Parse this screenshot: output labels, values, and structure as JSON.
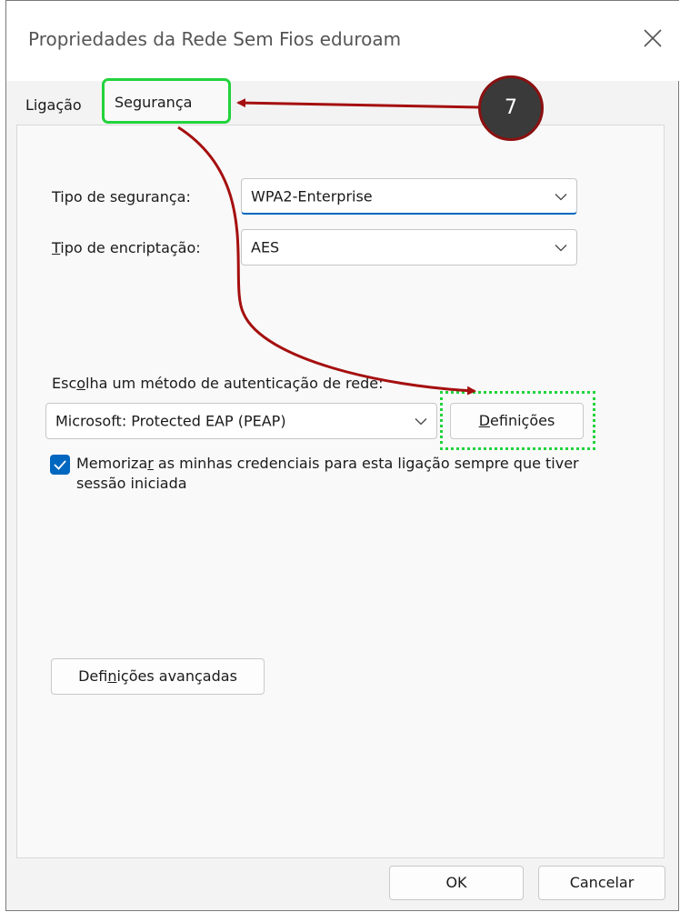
{
  "window": {
    "title": "Propriedades da Rede Sem Fios eduroam",
    "close_icon": "close-icon"
  },
  "tabs": [
    {
      "label": "Ligação"
    },
    {
      "label": "Segurança",
      "selected": true
    }
  ],
  "security": {
    "type_label": {
      "pre": "Tipo de se",
      "u": "g",
      "post": "urança:"
    },
    "type_value": "WPA2-Enterprise",
    "encryption_label": {
      "pre": "",
      "u": "T",
      "post": "ipo de encriptação:"
    },
    "encryption_value": "AES"
  },
  "auth": {
    "label": {
      "pre": "Esc",
      "u": "o",
      "post": "lha um método de autenticação de rede:"
    },
    "method_value": "Microsoft: Protected EAP (PEAP)",
    "settings_button": {
      "pre": "",
      "u": "D",
      "post": "efinições"
    }
  },
  "remember": {
    "checked": true,
    "label": {
      "pre": "Memoriza",
      "u": "r",
      "post": " as minhas credenciais para esta ligação sempre que tiver sessão iniciada"
    }
  },
  "advanced_button": {
    "pre": "Defi",
    "u": "n",
    "post": "ições avançadas"
  },
  "footer": {
    "ok_label": "OK",
    "cancel_label": "Cancelar"
  },
  "annotation": {
    "step_number": "7",
    "arrow_color": "#a50f0f",
    "highlight_color": "#22d33c"
  }
}
